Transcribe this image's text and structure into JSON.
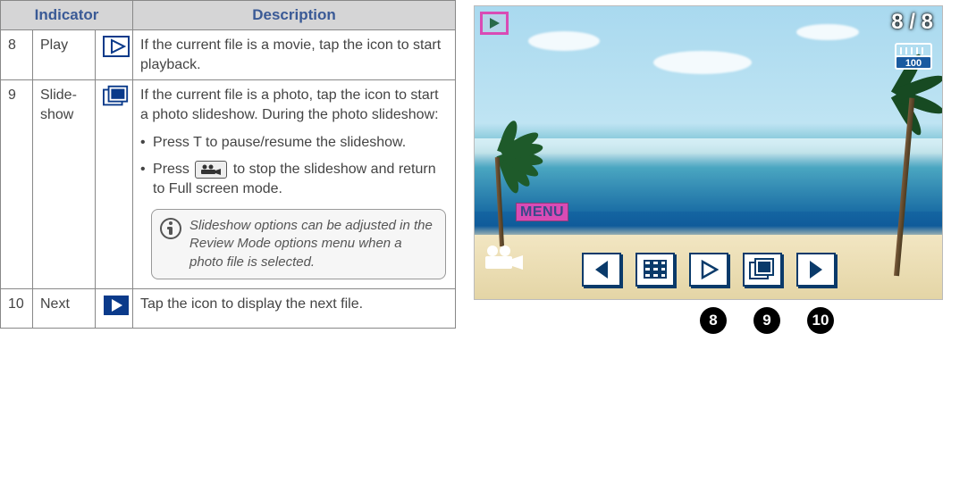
{
  "table": {
    "headers": {
      "indicator": "Indicator",
      "description": "Description"
    },
    "rows": [
      {
        "num": "8",
        "name": "Play",
        "desc_intro": "If the current file is a movie, tap the icon to start playback."
      },
      {
        "num": "9",
        "name": "Slide-show",
        "desc_intro": "If the current file is a photo, tap the icon to start a photo slideshow. During the photo slideshow:",
        "bullets": [
          "Press T to pause/resume the slideshow.",
          "Press  to stop the slideshow and return to Full screen mode."
        ],
        "bullet2_prefix": "Press ",
        "bullet2_suffix": " to stop the slideshow and return to Full screen mode.",
        "note": "Slideshow options can be adjusted in the Review Mode options menu when a photo file is selected."
      },
      {
        "num": "10",
        "name": "Next",
        "desc_intro": "Tap the icon to display the next file."
      }
    ]
  },
  "preview": {
    "counter": "8 / 8",
    "storage_label": "100",
    "menu_label": "MENU"
  },
  "callouts": [
    "8",
    "9",
    "10"
  ]
}
